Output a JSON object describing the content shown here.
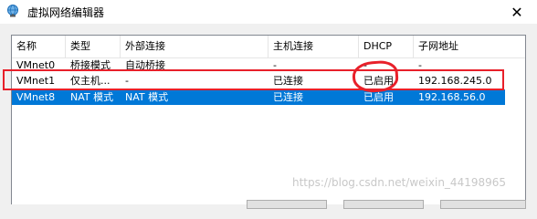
{
  "window": {
    "title": "虚拟网络编辑器",
    "close_glyph": "✕"
  },
  "table": {
    "columns": [
      "名称",
      "类型",
      "外部连接",
      "主机连接",
      "DHCP",
      "子网地址"
    ],
    "rows": [
      {
        "name": "VMnet0",
        "type": "桥接模式",
        "external": "自动桥接",
        "host": "-",
        "dhcp": "-",
        "subnet": "-",
        "selected": false
      },
      {
        "name": "VMnet1",
        "type": "仅主机...",
        "external": "-",
        "host": "已连接",
        "dhcp": "已启用",
        "subnet": "192.168.245.0",
        "selected": false
      },
      {
        "name": "VMnet8",
        "type": "NAT 模式",
        "external": "NAT 模式",
        "host": "已连接",
        "dhcp": "已启用",
        "subnet": "192.168.56.0",
        "selected": true
      }
    ]
  },
  "annotations": {
    "color": "#e8202a"
  },
  "watermark": "https://blog.csdn.net/weixin_44198965",
  "colors": {
    "selection": "#0078d7",
    "background": "#f0f0f0"
  }
}
